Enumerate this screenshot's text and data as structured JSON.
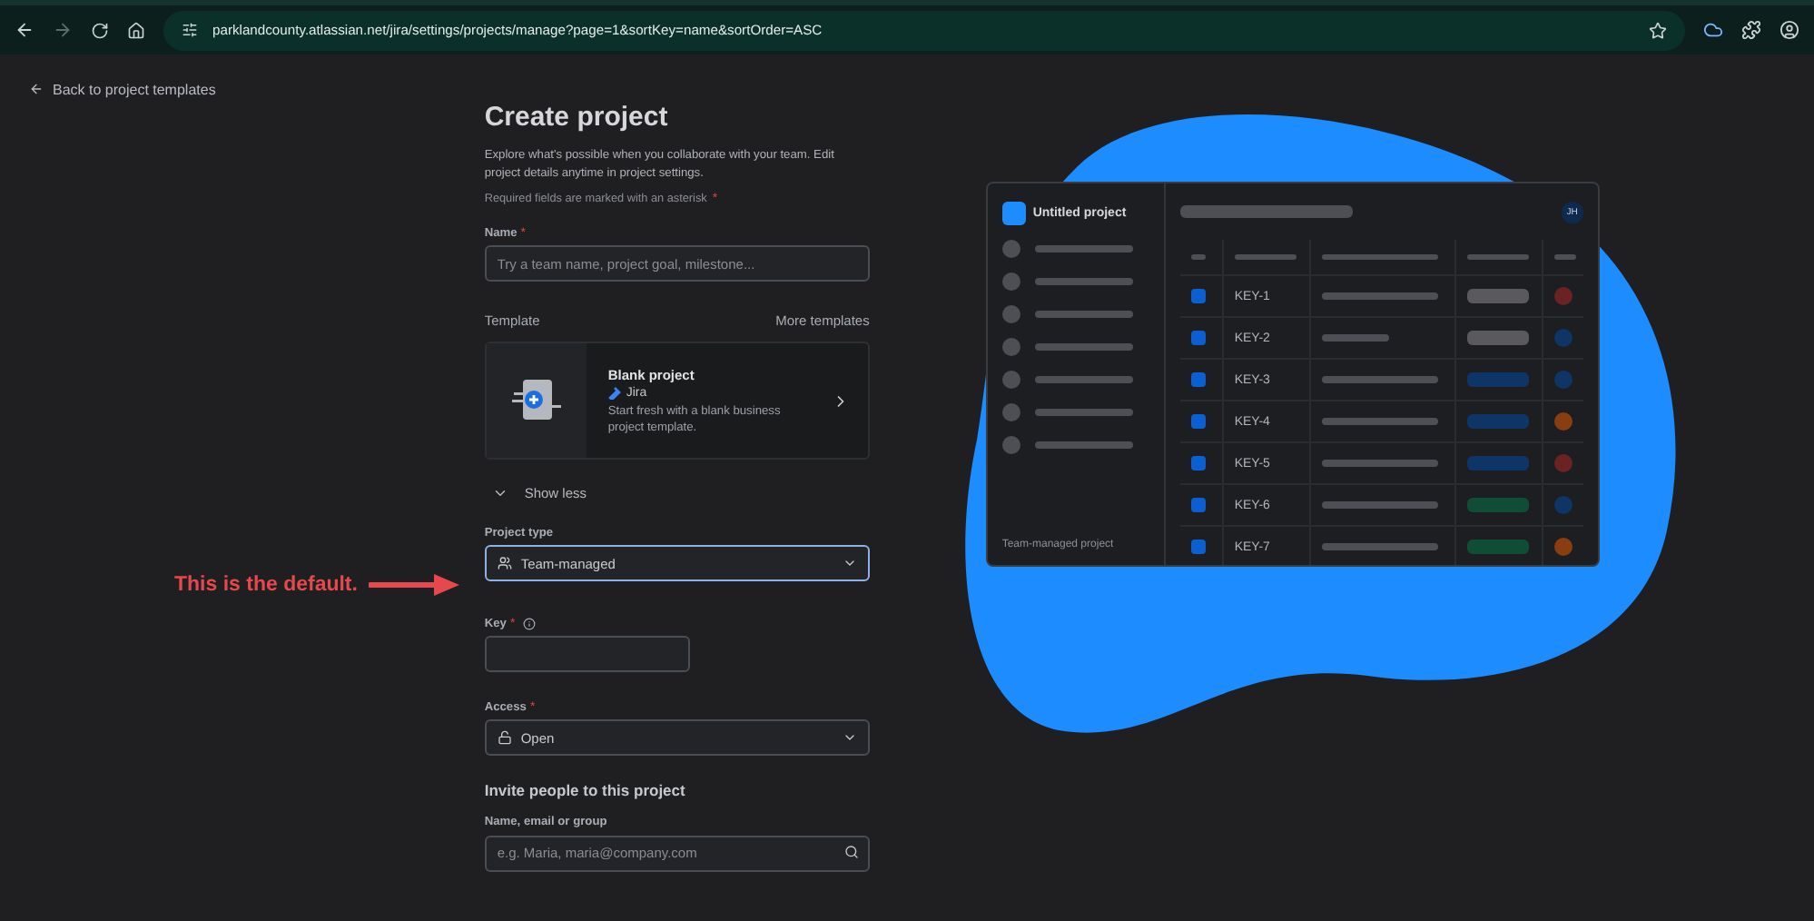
{
  "browser": {
    "url": "parklandcounty.atlassian.net/jira/settings/projects/manage?page=1&sortKey=name&sortOrder=ASC"
  },
  "back_link": "Back to project templates",
  "title": "Create project",
  "intro": "Explore what's possible when you collaborate with your team. Edit project details anytime in project settings.",
  "required_note": {
    "text": "Required fields are marked with an asterisk",
    "mark": "*"
  },
  "name_field": {
    "label": "Name",
    "mark": "*",
    "placeholder": "Try a team name, project goal, milestone..."
  },
  "template": {
    "label": "Template",
    "more": "More templates",
    "card": {
      "title": "Blank project",
      "product": "Jira",
      "description": "Start fresh with a blank business project template."
    }
  },
  "show_less": "Show less",
  "project_type": {
    "label": "Project type",
    "value": "Team-managed"
  },
  "key_field": {
    "label": "Key",
    "mark": "*"
  },
  "access": {
    "label": "Access",
    "mark": "*",
    "value": "Open"
  },
  "invite": {
    "heading": "Invite people to this project",
    "label": "Name, email or group",
    "placeholder": "e.g. Maria, maria@company.com"
  },
  "annotation": "This is the default.",
  "preview": {
    "project_name": "Untitled project",
    "avatar": "JH",
    "footer": "Team-managed project",
    "rows": [
      {
        "key": "KEY-1",
        "checked": true,
        "tag": {
          "color": "#5a5a5e"
        },
        "color": "#6b2222"
      },
      {
        "key": "KEY-2",
        "checked": true,
        "tag": {
          "color": "#5a5a5e"
        },
        "color": "#0f3566"
      },
      {
        "key": "KEY-3",
        "checked": true,
        "tag": {
          "color": "#0f3566"
        },
        "color": "#0f3566"
      },
      {
        "key": "KEY-4",
        "checked": true,
        "tag": {
          "color": "#0f3566"
        },
        "color": "#8a3d10"
      },
      {
        "key": "KEY-5",
        "checked": true,
        "tag": {
          "color": "#0f3566"
        },
        "color": "#6b2222"
      },
      {
        "key": "KEY-6",
        "checked": true,
        "tag": {
          "color": "#0f4d36"
        },
        "color": "#0f3566"
      },
      {
        "key": "KEY-7",
        "checked": true,
        "tag": {
          "color": "#0f4d36"
        },
        "color": "#8a3d10"
      }
    ]
  }
}
